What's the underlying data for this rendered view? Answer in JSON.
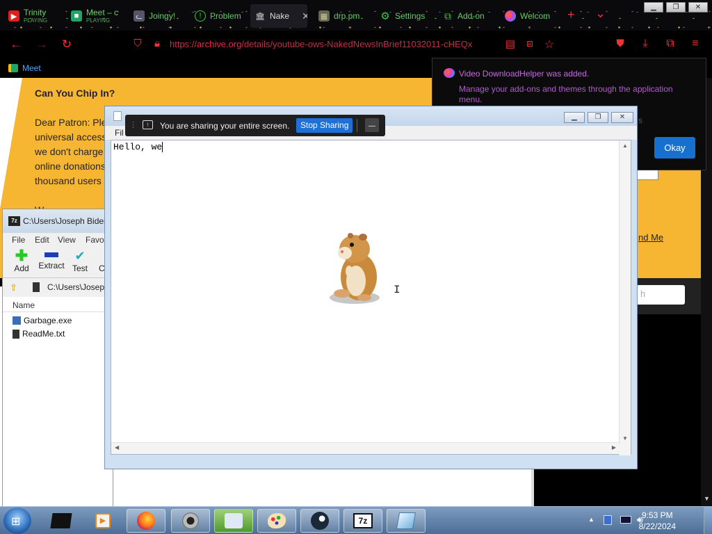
{
  "browser": {
    "tabs": [
      {
        "title": "Trinity",
        "sub": "PLAYING",
        "icon": "youtube-icon",
        "color": "#e02020"
      },
      {
        "title": "Meet – c",
        "sub": "PLAYING",
        "icon": "meet-icon",
        "color": "#21a464"
      },
      {
        "title": "Joingy!",
        "sub": "",
        "icon": "cat-icon",
        "color": "#8a8a9a"
      },
      {
        "title": "Problem",
        "sub": "",
        "icon": "info-circle-icon",
        "color": "#3c3"
      },
      {
        "title": "Nake",
        "sub": "",
        "icon": "archive-icon",
        "color": "#ddd"
      },
      {
        "title": "drp.pm",
        "sub": "",
        "icon": "image-icon",
        "color": "#775"
      },
      {
        "title": "Settings",
        "sub": "",
        "icon": "gear-icon",
        "color": "#3c3"
      },
      {
        "title": "Add-on",
        "sub": "",
        "icon": "puzzle-icon",
        "color": "#3c3"
      },
      {
        "title": "Welcom",
        "sub": "",
        "icon": "downloadhelper-icon",
        "color": "#c4c"
      }
    ],
    "new_tab": "+",
    "tab_list": "⌄",
    "url_prefix": "https://",
    "url_domain": "archive.org",
    "url_path": "/details/youtube-ows-NakedNewsInBrief11032011-cHEQx",
    "bookmark": "Meet"
  },
  "page": {
    "heading": "Can You Chip In?",
    "lines": [
      "Dear Patron: Ple",
      "universal access",
      "we don't charge",
      "online donations",
      "thousand users"
    ],
    "partial": "W",
    "right_link": "nd Me",
    "right_input": "h"
  },
  "notification": {
    "title": "Video DownloadHelper was added.",
    "body": "Manage your add-ons and themes through the application menu.",
    "okay": "Okay",
    "trailing": "s"
  },
  "zip": {
    "title": "C:\\Users\\Joseph Biden",
    "menu": [
      "File",
      "Edit",
      "View",
      "Favo"
    ],
    "toolbar": [
      "Add",
      "Extract",
      "Test",
      "C"
    ],
    "address": "C:\\Users\\Joseph",
    "column_name": "Name",
    "files": [
      {
        "name": "Garbage.exe",
        "icon": "exe-icon"
      },
      {
        "name": "ReadMe.txt",
        "icon": "txt-icon"
      }
    ]
  },
  "notepad": {
    "menu_partial": "Fil",
    "text": "Hello, we"
  },
  "sharing": {
    "message": "You are sharing your entire screen.",
    "stop": "Stop Sharing",
    "minimize": "—"
  },
  "taskbar": {
    "time": "9:53 PM",
    "date": "8/22/2024"
  }
}
